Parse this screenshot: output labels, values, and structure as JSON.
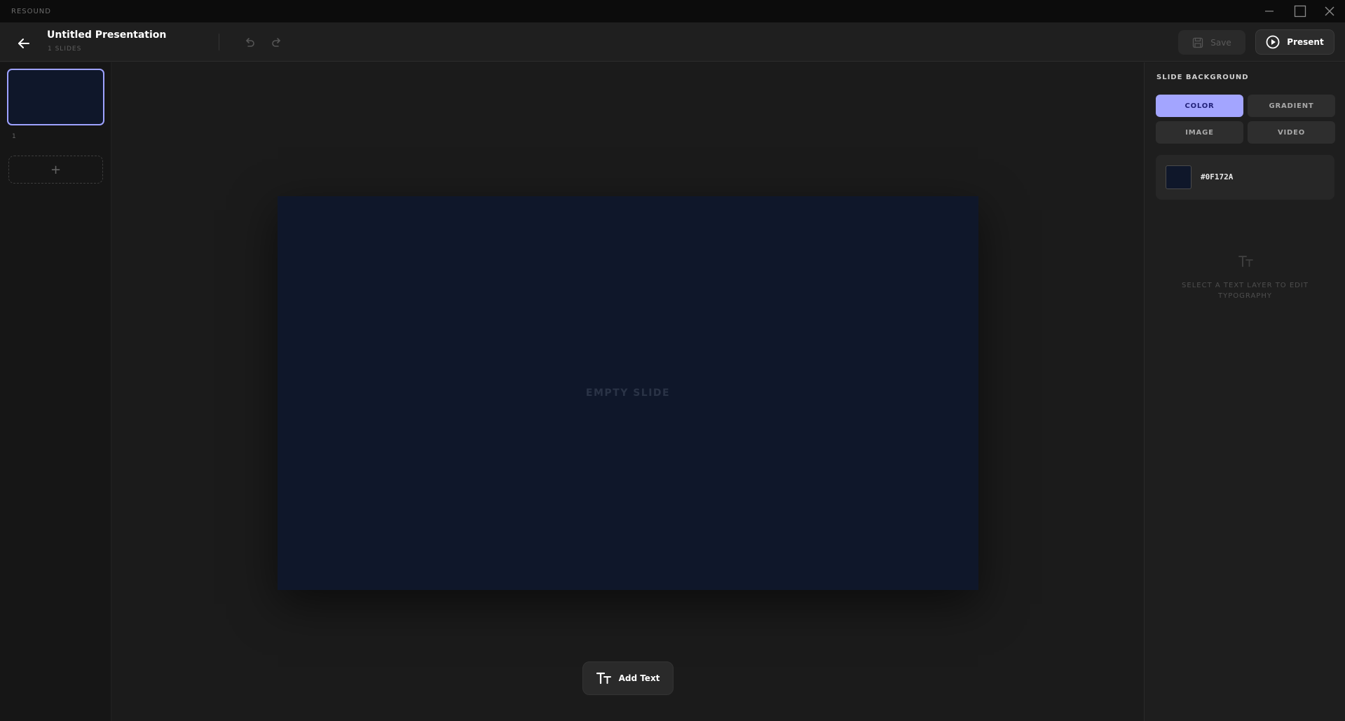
{
  "titlebar": {
    "app_name": "RESOUND"
  },
  "header": {
    "title": "Untitled Presentation",
    "slide_count": "1 SLIDES",
    "save_label": "Save",
    "present_label": "Present"
  },
  "slides": {
    "items": [
      {
        "number": "1",
        "background": "#0F172A"
      }
    ],
    "add_label": "+"
  },
  "canvas": {
    "empty_label": "EMPTY SLIDE",
    "add_text_label": "Add Text"
  },
  "inspector": {
    "heading": "SLIDE BACKGROUND",
    "bg_options": [
      {
        "label": "COLOR",
        "active": true
      },
      {
        "label": "GRADIENT",
        "active": false
      },
      {
        "label": "IMAGE",
        "active": false
      },
      {
        "label": "VIDEO",
        "active": false
      }
    ],
    "color_value": "#0F172A",
    "typography_hint": "SELECT A TEXT LAYER TO EDIT TYPOGRAPHY"
  },
  "colors": {
    "accent": "#A3A5FF",
    "slide_bg": "#0F172A",
    "app_bg": "#1B1B1B"
  },
  "icons": {
    "back": "arrow-left-icon",
    "undo": "undo-icon",
    "redo": "redo-icon",
    "save": "floppy-disk-icon",
    "present": "play-circle-icon",
    "add_text": "text-size-icon",
    "typography": "text-size-icon",
    "minimize": "minimize-icon",
    "maximize": "maximize-icon",
    "close": "close-icon"
  }
}
